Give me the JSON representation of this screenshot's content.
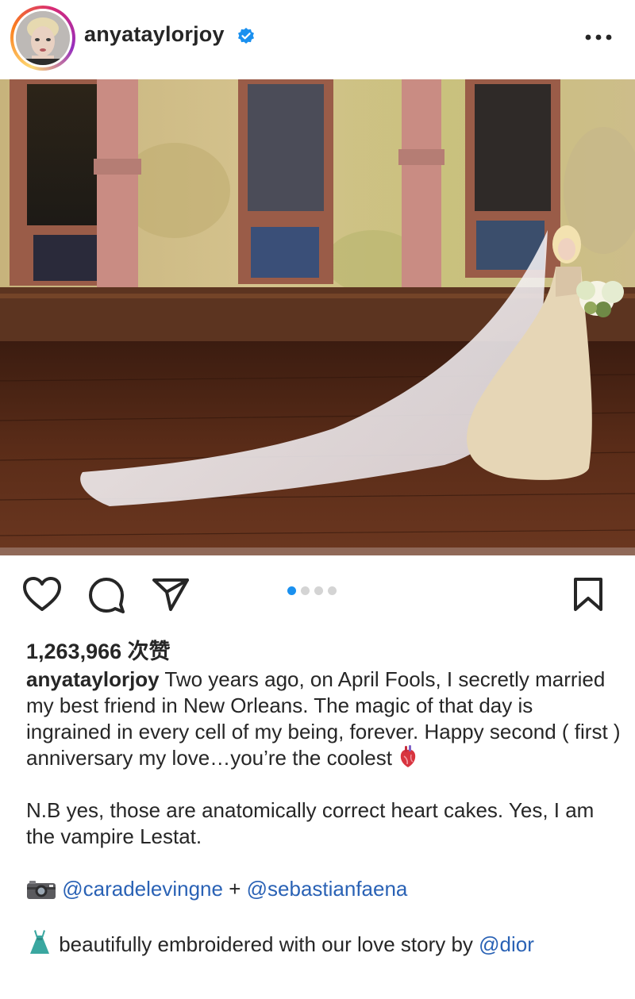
{
  "post": {
    "username": "anyataylorjoy",
    "verified": true,
    "likes": "1,263,966 次赞",
    "carousel": {
      "count": 4,
      "active_index": 0
    },
    "caption": {
      "username": "anyataylorjoy",
      "text_1": " Two years ago, on April Fools, I secretly married my best friend in New Orleans. The magic of that day is ingrained in every cell of my being, forever. Happy second ( first ) anniversary my love…you’re the coolest ",
      "text_2": "N.B yes, those are anatomically correct heart cakes. Yes, I am the vampire Lestat.",
      "credit_sep": " + ",
      "mention_1": "@caradelevingne",
      "mention_2": "@sebastianfaena",
      "text_3": " beautifully embroidered with our love story by ",
      "mention_3": "@dior"
    }
  },
  "colors": {
    "accent": "#1a90ef",
    "mention": "#2a62b5",
    "text": "#262626"
  },
  "icons": [
    "avatar",
    "verified-icon",
    "more-icon",
    "like-icon",
    "comment-icon",
    "share-icon",
    "save-icon",
    "anatomical-heart-icon",
    "camera-icon",
    "dress-icon"
  ]
}
